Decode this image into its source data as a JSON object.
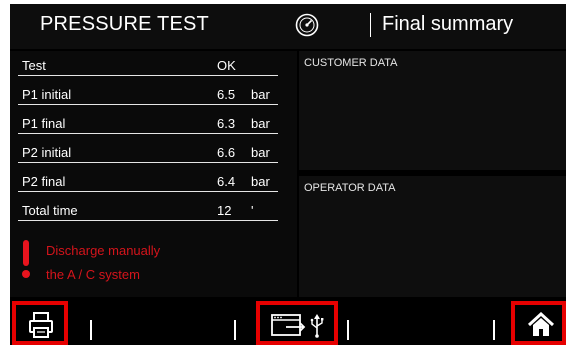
{
  "header": {
    "title": "PRESSURE TEST",
    "section": "Final summary",
    "icon": "gauge-icon"
  },
  "results": {
    "rows": [
      {
        "label": "Test",
        "value": "OK",
        "unit": ""
      },
      {
        "label": "P1 initial",
        "value": "6.5",
        "unit": "bar"
      },
      {
        "label": "P1 final",
        "value": "6.3",
        "unit": "bar"
      },
      {
        "label": "P2 initial",
        "value": "6.6",
        "unit": "bar"
      },
      {
        "label": "P2 final",
        "value": "6.4",
        "unit": "bar"
      },
      {
        "label": "Total time",
        "value": "12",
        "unit": "'"
      }
    ]
  },
  "warning": {
    "line1": "Discharge manually",
    "line2": "the A / C system",
    "color": "#d4141b",
    "icon": "exclamation-icon"
  },
  "customer_panel": {
    "title": "CUSTOMER DATA"
  },
  "operator_panel": {
    "title": "OPERATOR DATA"
  },
  "toolbar": {
    "print_icon": "printer-icon",
    "export_icon": "usb-export-icon",
    "home_icon": "home-icon",
    "highlight_color": "#e60000"
  }
}
